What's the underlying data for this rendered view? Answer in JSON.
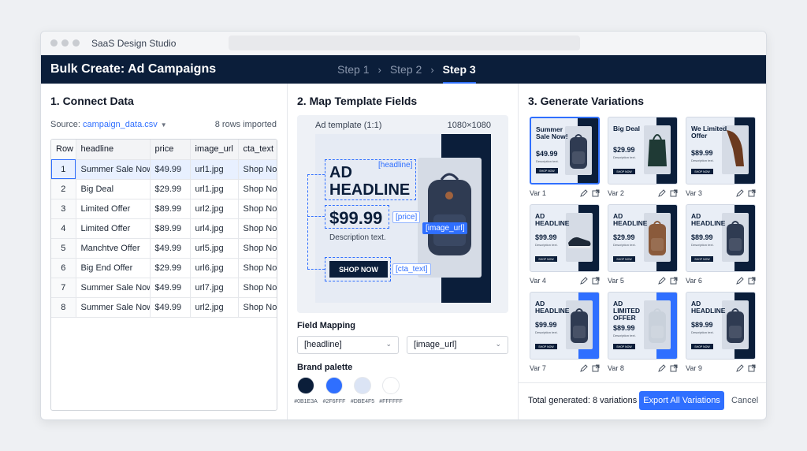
{
  "window": {
    "title": "SaaS Design Studio"
  },
  "header": {
    "title": "Bulk Create: Ad Campaigns",
    "steps": [
      "Step 1",
      "Step 2",
      "Step 3"
    ],
    "active_step": "Step 3"
  },
  "connect": {
    "title": "1. Connect Data",
    "source_label": "Source:",
    "source_file": "campaign_data.csv",
    "rows_imported": "8 rows imported",
    "columns": [
      "Row",
      "headline",
      "price",
      "image_url",
      "cta_text"
    ],
    "rows": [
      [
        "1",
        "Summer Sale Now!",
        "$49.99",
        "url1.jpg",
        "Shop Now"
      ],
      [
        "2",
        "Big Deal",
        "$29.99",
        "url1.jpg",
        "Shop Now"
      ],
      [
        "3",
        "Limited Offer",
        "$89.99",
        "url2.jpg",
        "Shop Now"
      ],
      [
        "4",
        "Limited Offer",
        "$89.99",
        "url4.jpg",
        "Shop Now"
      ],
      [
        "5",
        "Manchtve Offer",
        "$49.99",
        "url5.jpg",
        "Shop Now"
      ],
      [
        "6",
        "Big End Offer",
        "$29.99",
        "url6.jpg",
        "Shop Now"
      ],
      [
        "7",
        "Summer Sale Now!",
        "$49.99",
        "url7.jpg",
        "Shop Now"
      ],
      [
        "8",
        "Summer Sale Now!",
        "$49.99",
        "url2.jpg",
        "Shop Now"
      ]
    ]
  },
  "map": {
    "title": "2. Map Template Fields",
    "template_label": "Ad template (1:1)",
    "template_size": "1080×1080",
    "ad_headline": "AD\nHEADLINE",
    "ad_price": "$99.99",
    "ad_description": "Description text.",
    "ad_cta": "SHOP NOW",
    "tag_headline": "[headline]",
    "tag_price": "[price]",
    "tag_image": "[image_url]",
    "tag_cta": "[cta_text]",
    "field_mapping_label": "Field Mapping",
    "select_1": "[headline]",
    "select_2": "[image_url]",
    "brand_palette_label": "Brand palette",
    "palette": [
      "#0B1E3A",
      "#2F6FFF",
      "#DBE4F5",
      "#FFFFFF"
    ]
  },
  "generate": {
    "title": "3. Generate Variations",
    "variations": [
      {
        "label": "Var 1",
        "headline": "Summer Sale Now!",
        "price": "$49.99",
        "photo": "backpack"
      },
      {
        "label": "Var 2",
        "headline": "Big Deal",
        "price": "$29.99",
        "photo": "tote"
      },
      {
        "label": "Var 3",
        "headline": "We Limited Offer",
        "price": "$89.99",
        "photo": "boots"
      },
      {
        "label": "Var 4",
        "headline": "AD HEADLINE",
        "price": "$99.99",
        "photo": "sneaker"
      },
      {
        "label": "Var 5",
        "headline": "AD HEADLINE",
        "price": "$29.99",
        "photo": "brown-backpack"
      },
      {
        "label": "Var 6",
        "headline": "AD HEADLINE",
        "price": "$89.99",
        "photo": "backpack"
      },
      {
        "label": "Var 7",
        "headline": "AD HEADLINE",
        "price": "$99.99",
        "photo": "backpack"
      },
      {
        "label": "Var 8",
        "headline": "AD LIMITED OFFER",
        "price": "$89.99",
        "photo": "white-backpack"
      },
      {
        "label": "Var 9",
        "headline": "AD HEADLINE",
        "price": "$89.99",
        "photo": "backpack"
      }
    ],
    "var_description": "Description text.",
    "var_cta": "SHOP NOW",
    "total": "Total generated: 8 variations",
    "export_label": "Export All Variations",
    "cancel_label": "Cancel"
  }
}
